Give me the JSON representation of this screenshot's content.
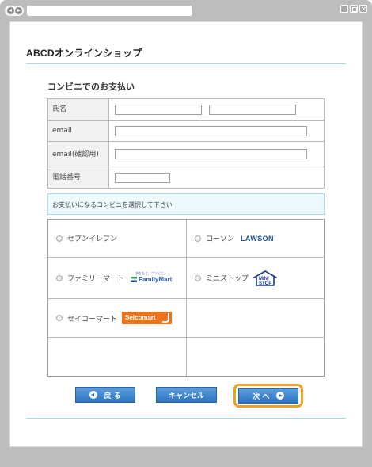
{
  "page": {
    "shop_title": "ABCDオンラインショップ",
    "section_title": "コンビニでのお支払い"
  },
  "form": {
    "name_label": "氏名",
    "email_label": "email",
    "email_confirm_label": "email(確認用)",
    "phone_label": "電話番号"
  },
  "notice": "お支払いになるコンビニを選択して下さい",
  "stores": {
    "seven": "セブンイレブン",
    "lawson": "ローソン",
    "lawson_logo": "LAWSON",
    "familymart": "ファミリーマート",
    "familymart_logo": "FamilyMart",
    "familymart_tag": "あなたと、コンビに、",
    "ministop": "ミニストップ",
    "ministop_logo": "MINI STOP",
    "seicomart": "セイコーマート",
    "seicomart_logo": "Seicomart"
  },
  "buttons": {
    "back": "戻 る",
    "cancel": "キャンセル",
    "next": "次 へ"
  },
  "colors": {
    "accent_blue": "#2d73c2",
    "highlight_orange": "#f0a020",
    "rule_cyan": "#a9dbe9"
  }
}
